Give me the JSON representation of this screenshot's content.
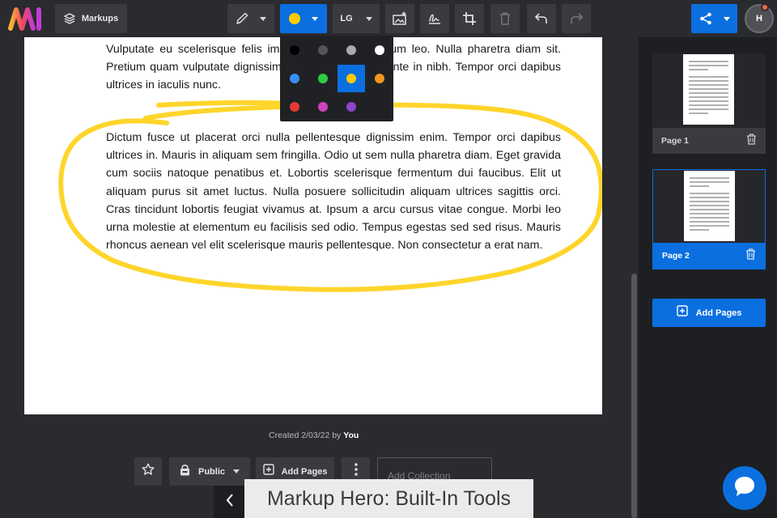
{
  "toolbar": {
    "markups_label": "Markups",
    "size_label": "LG",
    "accent_color": "#0b6fe0",
    "current_color": "#ffcc00",
    "avatar_initial": "H"
  },
  "color_palette": {
    "colors": [
      "#000000",
      "#555555",
      "#aaaaaa",
      "#ffffff",
      "#3a8ef6",
      "#2ecc40",
      "#ffcc00",
      "#f5961f",
      "#e53935",
      "#cc44bb",
      "#8e44cc"
    ],
    "selected": "#ffcc00"
  },
  "document": {
    "paragraph1": "Vulputate eu scelerisque felis imperdiet proin fermentum leo. Nulla pharetra diam sit. Pretium quam vulputate dignissim suspendisse in est ante in nibh. Tempor orci dapibus ultrices in iaculis nunc.",
    "paragraph2": "Dictum fusce ut placerat orci nulla pellentesque dignissim enim. Tempor orci dapibus ultrices in. Mauris in aliquam sem fringilla. Odio ut sem nulla pharetra diam. Eget gravida cum sociis natoque penatibus et. Lobortis scelerisque fermentum dui faucibus. Elit ut aliquam purus sit amet luctus. Nulla posuere sollicitudin aliquam ultrices sagittis orci. Cras tincidunt lobortis feugiat vivamus at. Ipsum a arcu cursus vitae congue. Morbi leo urna molestie at elementum eu facilisis sed odio. Tempus egestas sed sed risus. Mauris rhoncus aenean vel elit scelerisque mauris pellentesque. Non consectetur a erat nam.",
    "created_prefix": "Created 2/03/22 by",
    "created_by": "You"
  },
  "actions": {
    "visibility_label": "Public",
    "add_pages_label": "Add Pages",
    "collection_placeholder": "Add Collection"
  },
  "pages_panel": {
    "pages": [
      {
        "label": "Page 1",
        "active": false
      },
      {
        "label": "Page 2",
        "active": true
      }
    ],
    "add_pages_label": "Add Pages"
  },
  "caption": "Markup Hero: Built-In Tools"
}
